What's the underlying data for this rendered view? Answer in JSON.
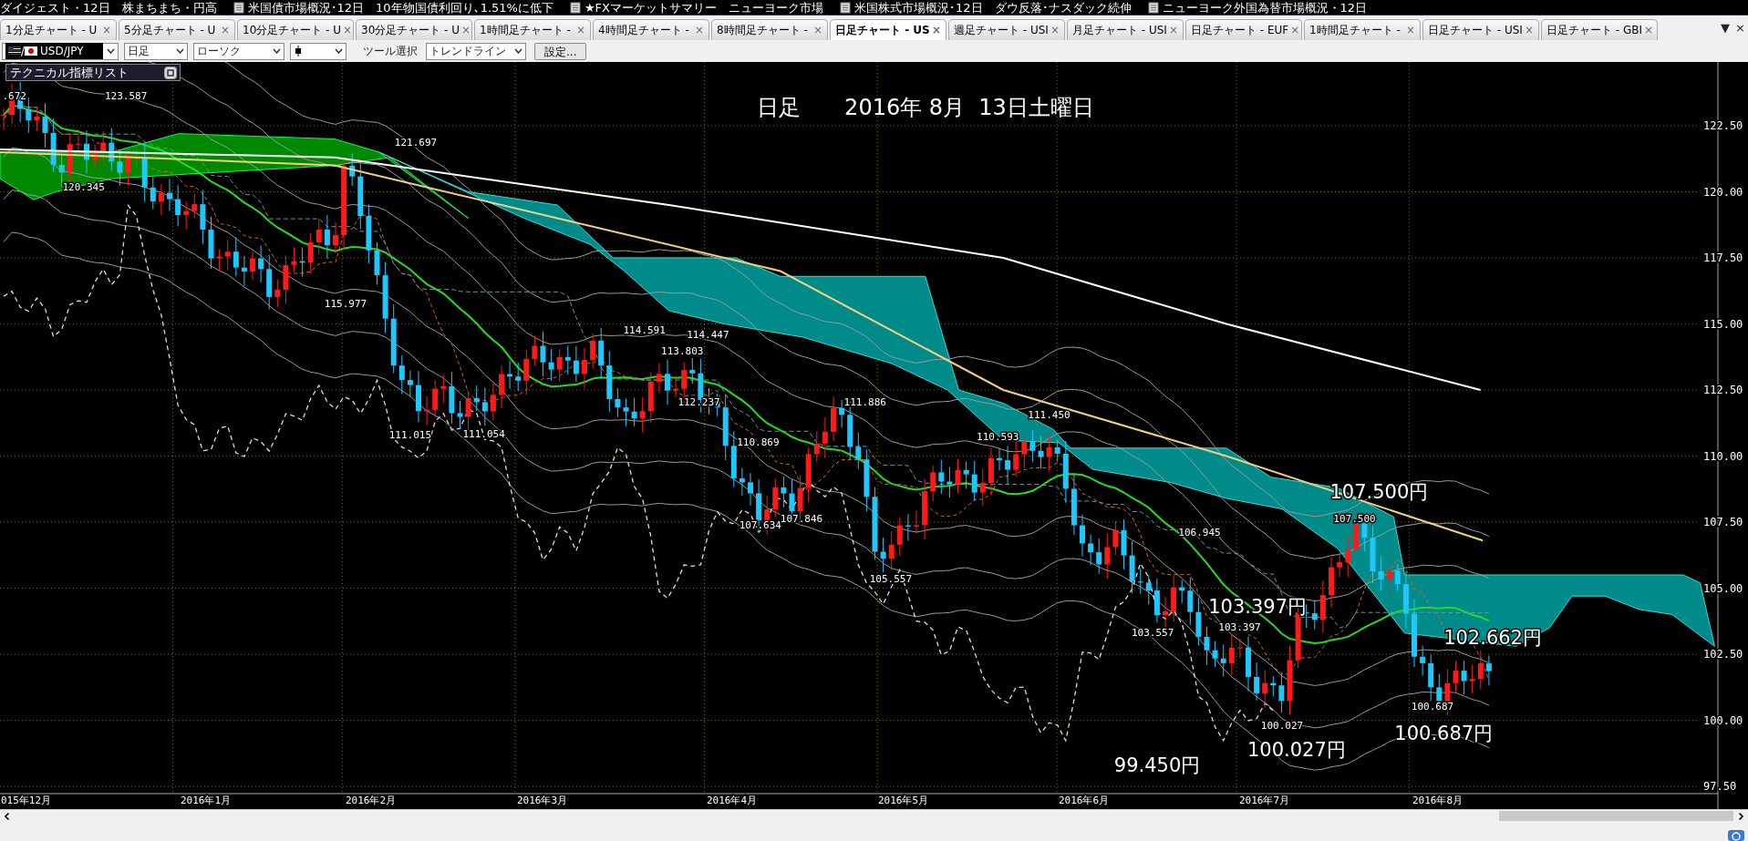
{
  "ticker": [
    "ダイジェスト・12日　株まちまち・円高",
    "米国債市場概況･12日　10年物国債利回り､1.51%に低下",
    "★FXマーケットサマリー　ニューヨーク市場",
    "米国株式市場概況･12日　ダウ反落･ナスダック続伸",
    "ニューヨーク外国為替市場概況・12日"
  ],
  "tabs": [
    {
      "label": "1分足チャート - U",
      "close": "×",
      "selected": false
    },
    {
      "label": "5分足チャート - U",
      "close": "×",
      "selected": false
    },
    {
      "label": "10分足チャート - U",
      "close": "×",
      "selected": false
    },
    {
      "label": "30分足チャート - U",
      "close": "×",
      "selected": false
    },
    {
      "label": "1時間足チャート -",
      "close": "×",
      "selected": false
    },
    {
      "label": "4時間足チャート -",
      "close": "×",
      "selected": false
    },
    {
      "label": "8時間足チャート -",
      "close": "×",
      "selected": false
    },
    {
      "label": "日足チャート - US",
      "close": "×",
      "selected": true
    },
    {
      "label": "週足チャート - USI",
      "close": "×",
      "selected": false
    },
    {
      "label": "月足チャート - USI",
      "close": "×",
      "selected": false
    },
    {
      "label": "日足チャート - EUF",
      "close": "×",
      "selected": false
    },
    {
      "label": "1時間足チャート -",
      "close": "×",
      "selected": false
    },
    {
      "label": "日足チャート - USI",
      "close": "×",
      "selected": false
    },
    {
      "label": "日足チャート - GBI",
      "close": "×",
      "selected": false
    }
  ],
  "tab_controls": [
    "▼",
    "×"
  ],
  "toolbar": {
    "flag_separator": "/",
    "symbol": "USD/JPY",
    "timeframe": "日足",
    "chart_type": "ローソク",
    "tool_label": "ツール選択",
    "tool": "トレンドライン",
    "settings_button": "設定..."
  },
  "chart": {
    "title": "日足　　2016年 8月  13日土曜日",
    "indicator_panel": "テクニカル指標リスト",
    "y_axis_labels": [
      "122.50",
      "120.00",
      "117.50",
      "115.00",
      "112.50",
      "110.00",
      "107.50",
      "105.00",
      "102.50",
      "100.00",
      "97.50"
    ],
    "x_axis_labels": [
      "015年12月",
      "2016年1月",
      "2016年2月",
      "2016年3月",
      "2016年4月",
      "2016年5月",
      "2016年6月",
      "2016年7月",
      "2016年8月"
    ],
    "price_labels": [
      ".672",
      "123.587",
      "120.345",
      "121.697",
      "115.977",
      "114.591",
      "114.447",
      "113.803",
      "111.015",
      "111.054",
      "112.237",
      "110.869",
      "111.886",
      "110.593",
      "111.450",
      "107.634",
      "107.846",
      "105.557",
      "106.945",
      "103.557",
      "103.397",
      "100.027",
      "107.500",
      "100.687"
    ],
    "annotations": [
      "107.500円",
      "103.397円",
      "102.662円",
      "99.450円",
      "100.027円",
      "100.687円"
    ]
  }
}
